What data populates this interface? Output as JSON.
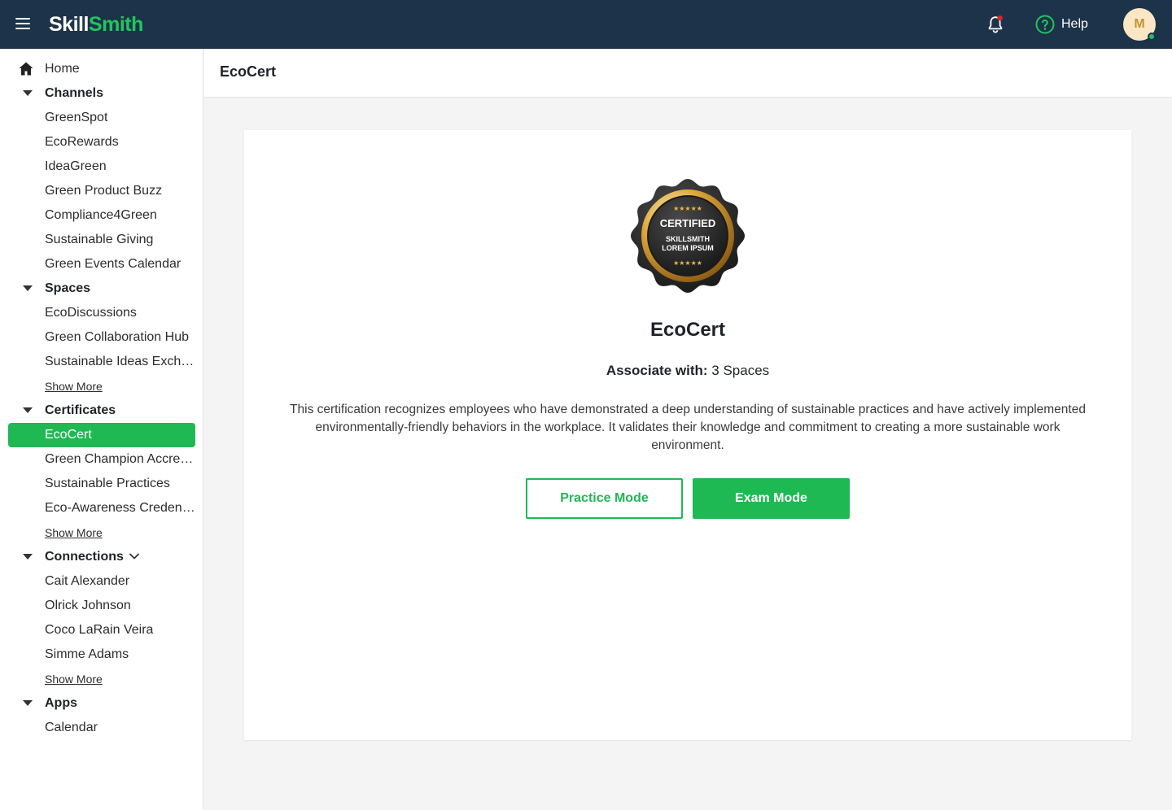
{
  "app": {
    "logo_part1": "Skill",
    "logo_part2": "Smith",
    "help_label": "Help",
    "avatar_initial": "M",
    "notification_dot_color": "#e02424",
    "accent_color": "#1fb954",
    "header_bg": "#1d3349"
  },
  "sidebar": {
    "home": "Home",
    "channels": {
      "label": "Channels",
      "items": [
        "GreenSpot",
        "EcoRewards",
        "IdeaGreen",
        "Green Product Buzz",
        "Compliance4Green",
        "Sustainable Giving",
        "Green Events Calendar"
      ]
    },
    "spaces": {
      "label": "Spaces",
      "items": [
        "EcoDiscussions",
        "Green Collaboration Hub",
        "Sustainable Ideas Exchange"
      ],
      "show_more": "Show More"
    },
    "certificates": {
      "label": "Certificates",
      "items": [
        "EcoCert",
        "Green Champion Accreditation",
        "Sustainable Practices",
        "Eco-Awareness Credential"
      ],
      "active": "EcoCert",
      "show_more": "Show More"
    },
    "connections": {
      "label": "Connections",
      "items": [
        "Cait Alexander",
        "Olrick Johnson",
        "Coco LaRain Veira",
        "Simme Adams"
      ],
      "show_more": "Show More"
    },
    "apps": {
      "label": "Apps",
      "items": [
        "Calendar"
      ]
    }
  },
  "main": {
    "page_title": "EcoCert",
    "badge": {
      "line1": "CERTIFIED",
      "line2": "SKILLSMITH",
      "line3": "LOREM IPSUM",
      "stars": "★★★★★"
    },
    "cert_name": "EcoCert",
    "associate_label": "Associate with:",
    "associate_value": "3 Spaces",
    "description": "This certification recognizes employees who have demonstrated a deep understanding of sustainable practices and have actively implemented environmentally-friendly behaviors in the workplace. It validates their knowledge and commitment to creating a more sustainable work environment.",
    "practice_button": "Practice Mode",
    "exam_button": "Exam Mode"
  }
}
